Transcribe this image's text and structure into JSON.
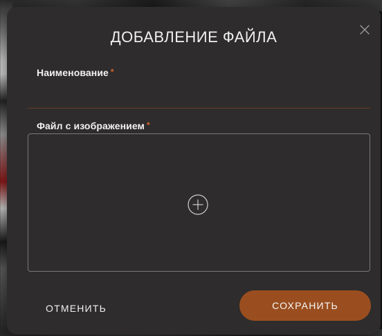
{
  "dialog": {
    "title": "ДОБАВЛЕНИЕ ФАЙЛА",
    "close_icon": "close-icon"
  },
  "fields": {
    "name": {
      "label": "Наименование",
      "required_mark": "*",
      "value": "",
      "placeholder": ""
    },
    "image_file": {
      "label": "Файл с изображением",
      "required_mark": "*",
      "upload_icon": "plus-circle-icon"
    }
  },
  "actions": {
    "cancel_label": "ОТМЕНИТЬ",
    "save_label": "СОХРАНИТЬ"
  },
  "colors": {
    "modal_bg": "#2e2c2c",
    "accent": "#9a4e1f",
    "required": "#d6662d",
    "divider": "#6a3e26"
  }
}
